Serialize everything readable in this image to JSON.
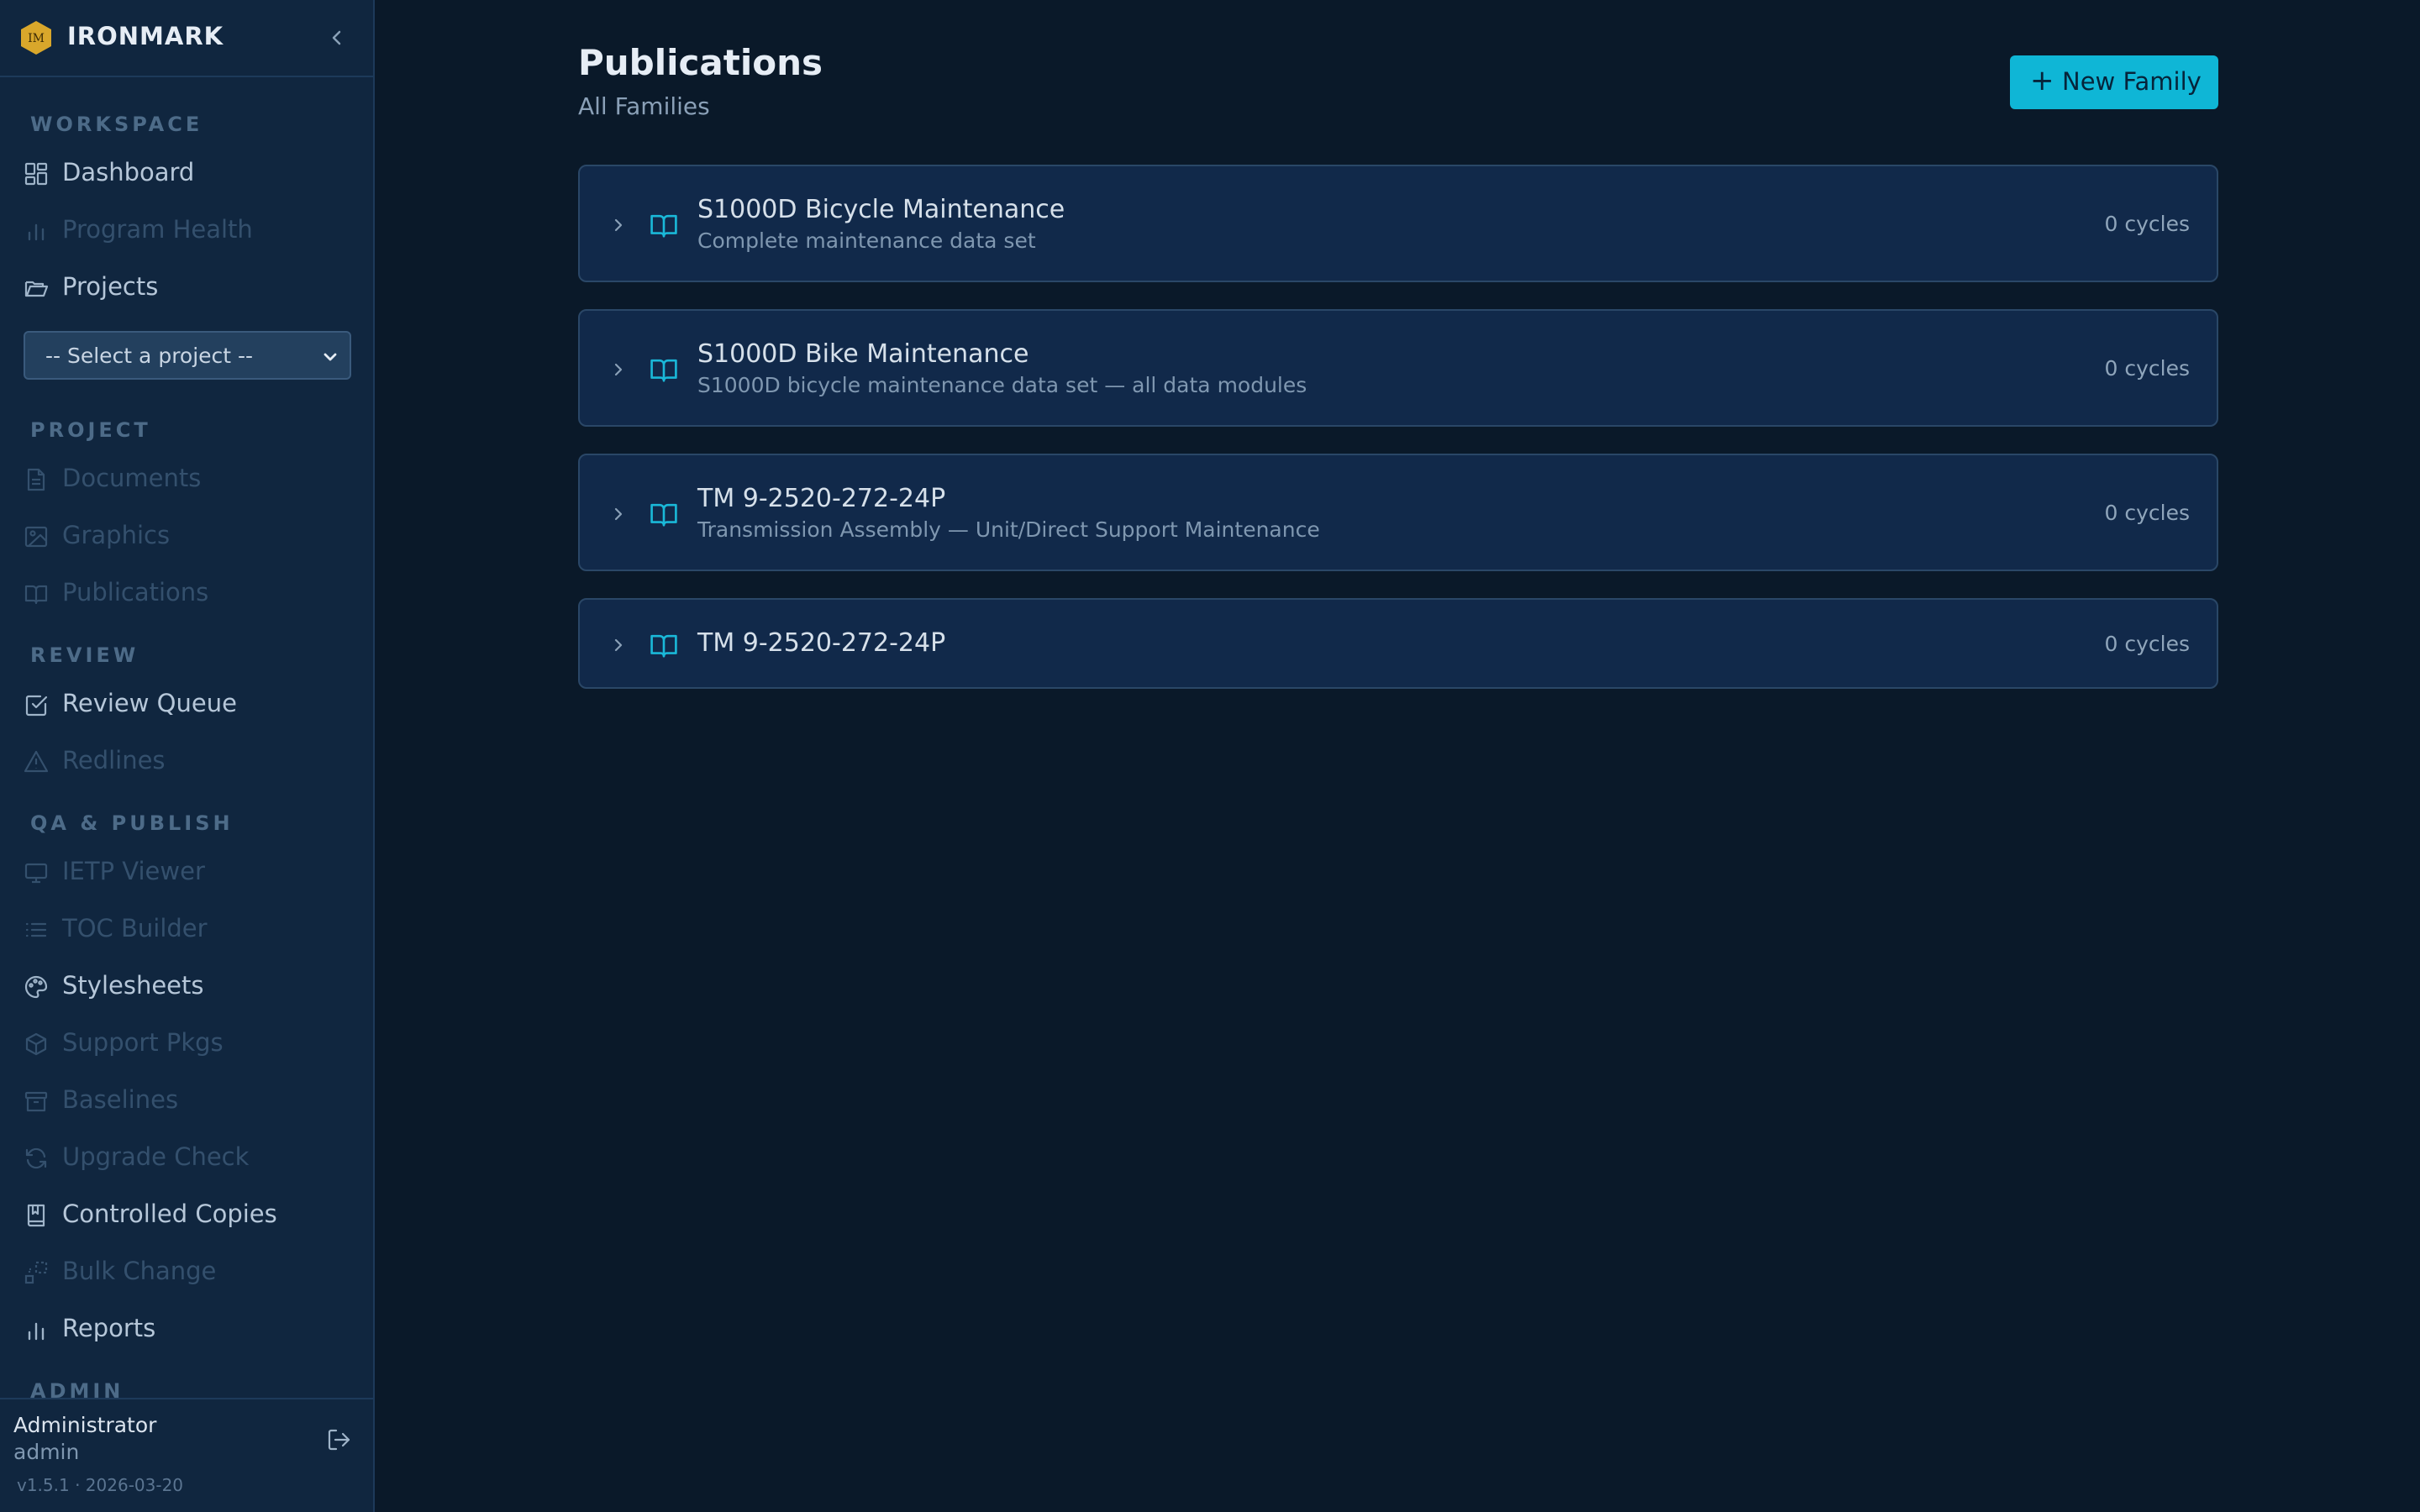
{
  "app": {
    "name": "IRONMARK",
    "logo_text": "IM"
  },
  "colors": {
    "accent": "#0fb6d6",
    "logo": "#d9a72b",
    "background": "#0a1929",
    "sidebar": "#10263f"
  },
  "sidebar": {
    "sections": {
      "workspace": "WORKSPACE",
      "project": "PROJECT",
      "review": "REVIEW",
      "qa_publish": "QA & PUBLISH",
      "admin": "ADMIN"
    },
    "items": {
      "dashboard": "Dashboard",
      "program_health": "Program Health",
      "projects": "Projects",
      "documents": "Documents",
      "graphics": "Graphics",
      "publications": "Publications",
      "review_queue": "Review Queue",
      "redlines": "Redlines",
      "ietp_viewer": "IETP Viewer",
      "toc_builder": "TOC Builder",
      "stylesheets": "Stylesheets",
      "support_pkgs": "Support Pkgs",
      "baselines": "Baselines",
      "upgrade_check": "Upgrade Check",
      "controlled_copies": "Controlled Copies",
      "bulk_change": "Bulk Change",
      "reports": "Reports"
    },
    "project_select": {
      "value": "-- Select a project --"
    }
  },
  "user": {
    "name": "Administrator",
    "role": "admin",
    "version": "v1.5.1 · 2026-03-20"
  },
  "main": {
    "title": "Publications",
    "subtitle": "All Families",
    "new_button": "New Family",
    "new_button_icon": "+",
    "families": [
      {
        "name": "S1000D Bicycle Maintenance",
        "description": "Complete maintenance data set",
        "cycles": "0 cycles"
      },
      {
        "name": "S1000D Bike Maintenance",
        "description": "S1000D bicycle maintenance data set — all data modules",
        "cycles": "0 cycles"
      },
      {
        "name": "TM 9-2520-272-24P",
        "description": "Transmission Assembly — Unit/Direct Support Maintenance",
        "cycles": "0 cycles"
      },
      {
        "name": "TM 9-2520-272-24P",
        "description": "",
        "cycles": "0 cycles"
      }
    ]
  }
}
